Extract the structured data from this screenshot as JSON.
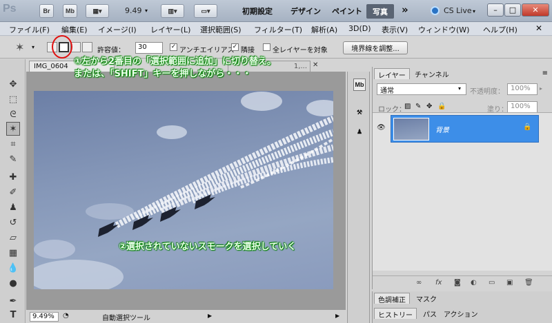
{
  "titlebar": {
    "app_logo": "Ps",
    "bridge_btn": "Br",
    "minibridge_btn": "Mb",
    "zoom": "9.49",
    "workspaces": [
      "初期設定",
      "デザイン",
      "ペイント"
    ],
    "active_workspace": "写真",
    "more": "»",
    "cs_live": "CS Live",
    "win_min": "–",
    "win_max": "□",
    "win_close": "✕"
  },
  "menu": {
    "items": [
      "ファイル(F)",
      "編集(E)",
      "イメージ(I)",
      "レイヤー(L)",
      "選択範囲(S)",
      "フィルター(T)",
      "解析(A)",
      "3D(D)",
      "表示(V)",
      "ウィンドウ(W)",
      "ヘルプ(H)"
    ]
  },
  "options": {
    "tolerance_label": "許容値：",
    "tolerance_value": "30",
    "antialias_label": "アンチエイリアス",
    "antialias_checked": "✓",
    "contiguous_label": "隣接",
    "contiguous_checked": "✓",
    "all_layers_label": "全レイヤーを対象",
    "refine_edge": "境界線を調整..."
  },
  "notes": {
    "line1": "①左から2番目の「選択範囲に追加」に切り替え。",
    "line2": "または、「SHIFT」キーを押しながら・・・",
    "line3": "②選択されていないスモークを選択していく"
  },
  "document": {
    "tab_label": "IMG_0604",
    "tab2_label": "",
    "tab2_suffix": "1,...",
    "zoom_status": "9.49%",
    "tool_status": "自動選択ツール"
  },
  "panel": {
    "tabs": [
      "レイヤー",
      "チャンネル"
    ],
    "blend_mode": "通常",
    "opacity_label": "不透明度：",
    "opacity_value": "100%",
    "lock_label": "ロック：",
    "fill_label": "塗り：",
    "fill_value": "100%",
    "layer_name": "背景"
  },
  "bottom_panels": {
    "row1": [
      "色調補正",
      "マスク"
    ],
    "row2": [
      "ヒストリー",
      "パス",
      "アクション"
    ]
  }
}
